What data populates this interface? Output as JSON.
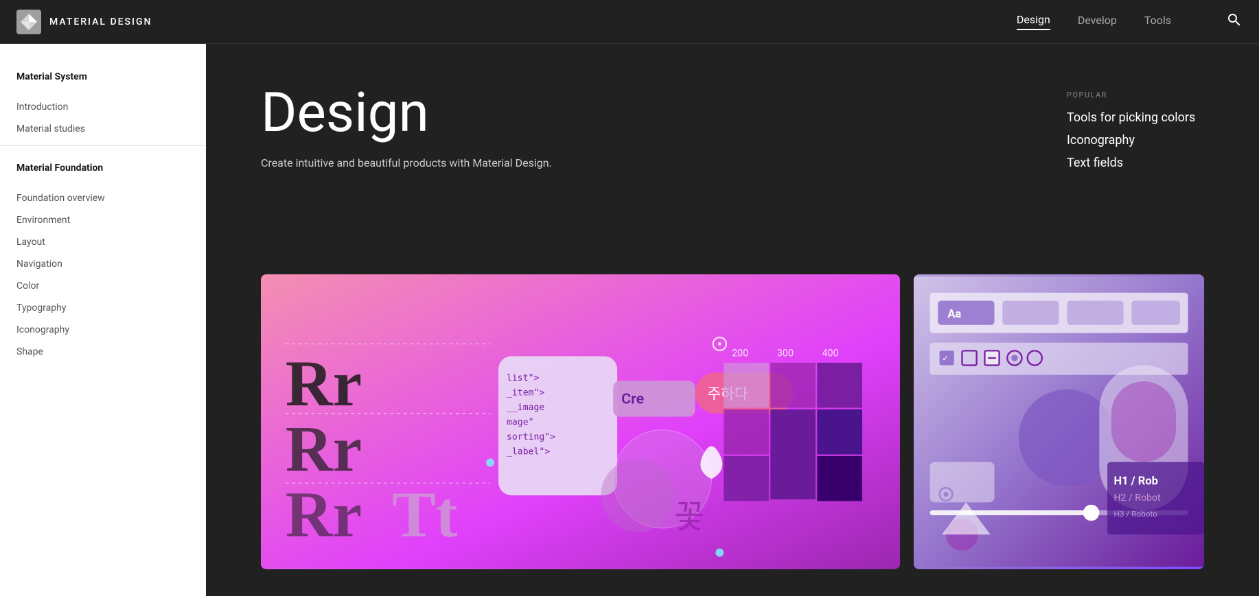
{
  "topnav": {
    "brand": "MATERIAL DESIGN",
    "links": [
      {
        "label": "Design",
        "active": true
      },
      {
        "label": "Develop",
        "active": false
      },
      {
        "label": "Tools",
        "active": false
      }
    ],
    "search_label": "search"
  },
  "sidebar": {
    "sections": [
      {
        "id": "material-system",
        "title": "Material System",
        "items": [
          {
            "label": "Introduction"
          },
          {
            "label": "Material studies"
          }
        ]
      },
      {
        "id": "material-foundation",
        "title": "Material Foundation",
        "items": [
          {
            "label": "Foundation overview"
          },
          {
            "label": "Environment"
          },
          {
            "label": "Layout"
          },
          {
            "label": "Navigation"
          },
          {
            "label": "Color"
          },
          {
            "label": "Typography"
          },
          {
            "label": "Iconography"
          },
          {
            "label": "Shape"
          }
        ]
      }
    ]
  },
  "hero": {
    "title": "Design",
    "subtitle": "Create intuitive and beautiful products with Material Design.",
    "popular_label": "POPULAR",
    "popular_links": [
      "Tools for picking colors",
      "Iconography",
      "Text fields"
    ]
  },
  "cards": [
    {
      "id": "design-card",
      "type": "design"
    },
    {
      "id": "tool-card",
      "type": "tool"
    }
  ]
}
